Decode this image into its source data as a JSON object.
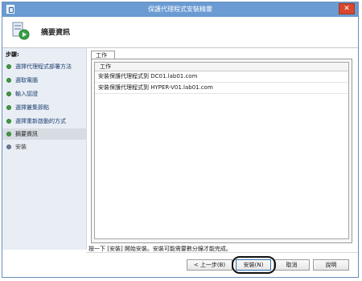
{
  "window": {
    "title": "保護代理程式安裝精靈",
    "close_glyph": "✕"
  },
  "header": {
    "title": "摘要資訊"
  },
  "sidebar": {
    "heading": "步驟:",
    "steps": [
      {
        "label": "選擇代理程式部署方法",
        "state": "done"
      },
      {
        "label": "選取電腦",
        "state": "done"
      },
      {
        "label": "輸入認證",
        "state": "done"
      },
      {
        "label": "選擇叢集節點",
        "state": "done"
      },
      {
        "label": "選擇重新啟動的方式",
        "state": "done"
      },
      {
        "label": "摘要資訊",
        "state": "current"
      },
      {
        "label": "安裝",
        "state": "pending"
      }
    ]
  },
  "main": {
    "tab_label": "工作",
    "list_header": "工作",
    "tasks": [
      "安裝保護代理程式到 DC01.lab01.com",
      "安裝保護代理程式到 HYPER-V01.lab01.com"
    ]
  },
  "status_text": "按一下 [安裝] 開始安裝。安裝可能需要數分鐘才能完成。",
  "buttons": {
    "back": "< 上一步(B)",
    "install": "安裝(N)",
    "cancel": "取消",
    "help": "說明"
  },
  "icons": {
    "window": "wizard-icon",
    "header": "protection-agent-icon",
    "step_done": "green-dot-icon",
    "step_pending": "gray-dot-icon"
  },
  "colors": {
    "titlebar": "#6a9bd2",
    "close_button": "#d9472e",
    "sidebar": "#e9eef5",
    "highlight_ring": "#111111"
  }
}
